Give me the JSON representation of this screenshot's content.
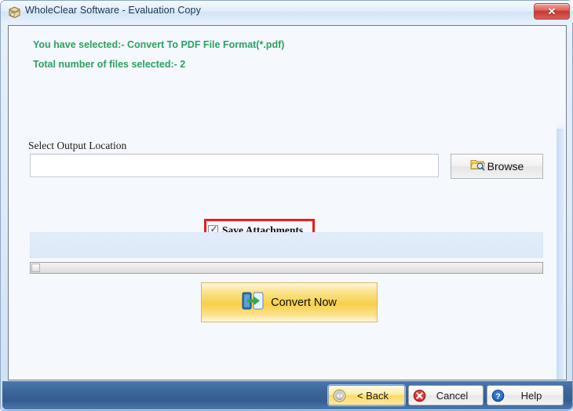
{
  "window": {
    "title": "WholeClear Software - Evaluation Copy",
    "title_icon": "app-box-icon",
    "close_label": "✕"
  },
  "content": {
    "selection_info": "You have selected:- Convert  To PDF File Format(*.pdf)",
    "files_info": "Total number of files selected:- 2",
    "output": {
      "label": "Select Output Location",
      "value": "",
      "placeholder": "",
      "browse_label": "Browse",
      "browse_icon": "folder-search-icon"
    },
    "attachments": {
      "label": "Save Attachments",
      "checked": true,
      "check_glyph": "✓",
      "highlight_color": "#ed1c1c"
    },
    "progress": {
      "panel_text": "",
      "scrollbar_position": "left"
    },
    "convert": {
      "label": "Convert Now",
      "icon": "convert-arrow-icon"
    }
  },
  "footer": {
    "buttons": [
      {
        "label": "< Back",
        "icon": "rewind-icon"
      },
      {
        "label": "Cancel",
        "icon": "cancel-circle-icon"
      },
      {
        "label": "Help",
        "icon": "help-circle-icon"
      }
    ]
  },
  "colors": {
    "info_green": "#2aa25f",
    "footer_blue": "#3c6699",
    "convert_gold": "#f7cf4a",
    "highlight_red": "#ed1c1c"
  }
}
